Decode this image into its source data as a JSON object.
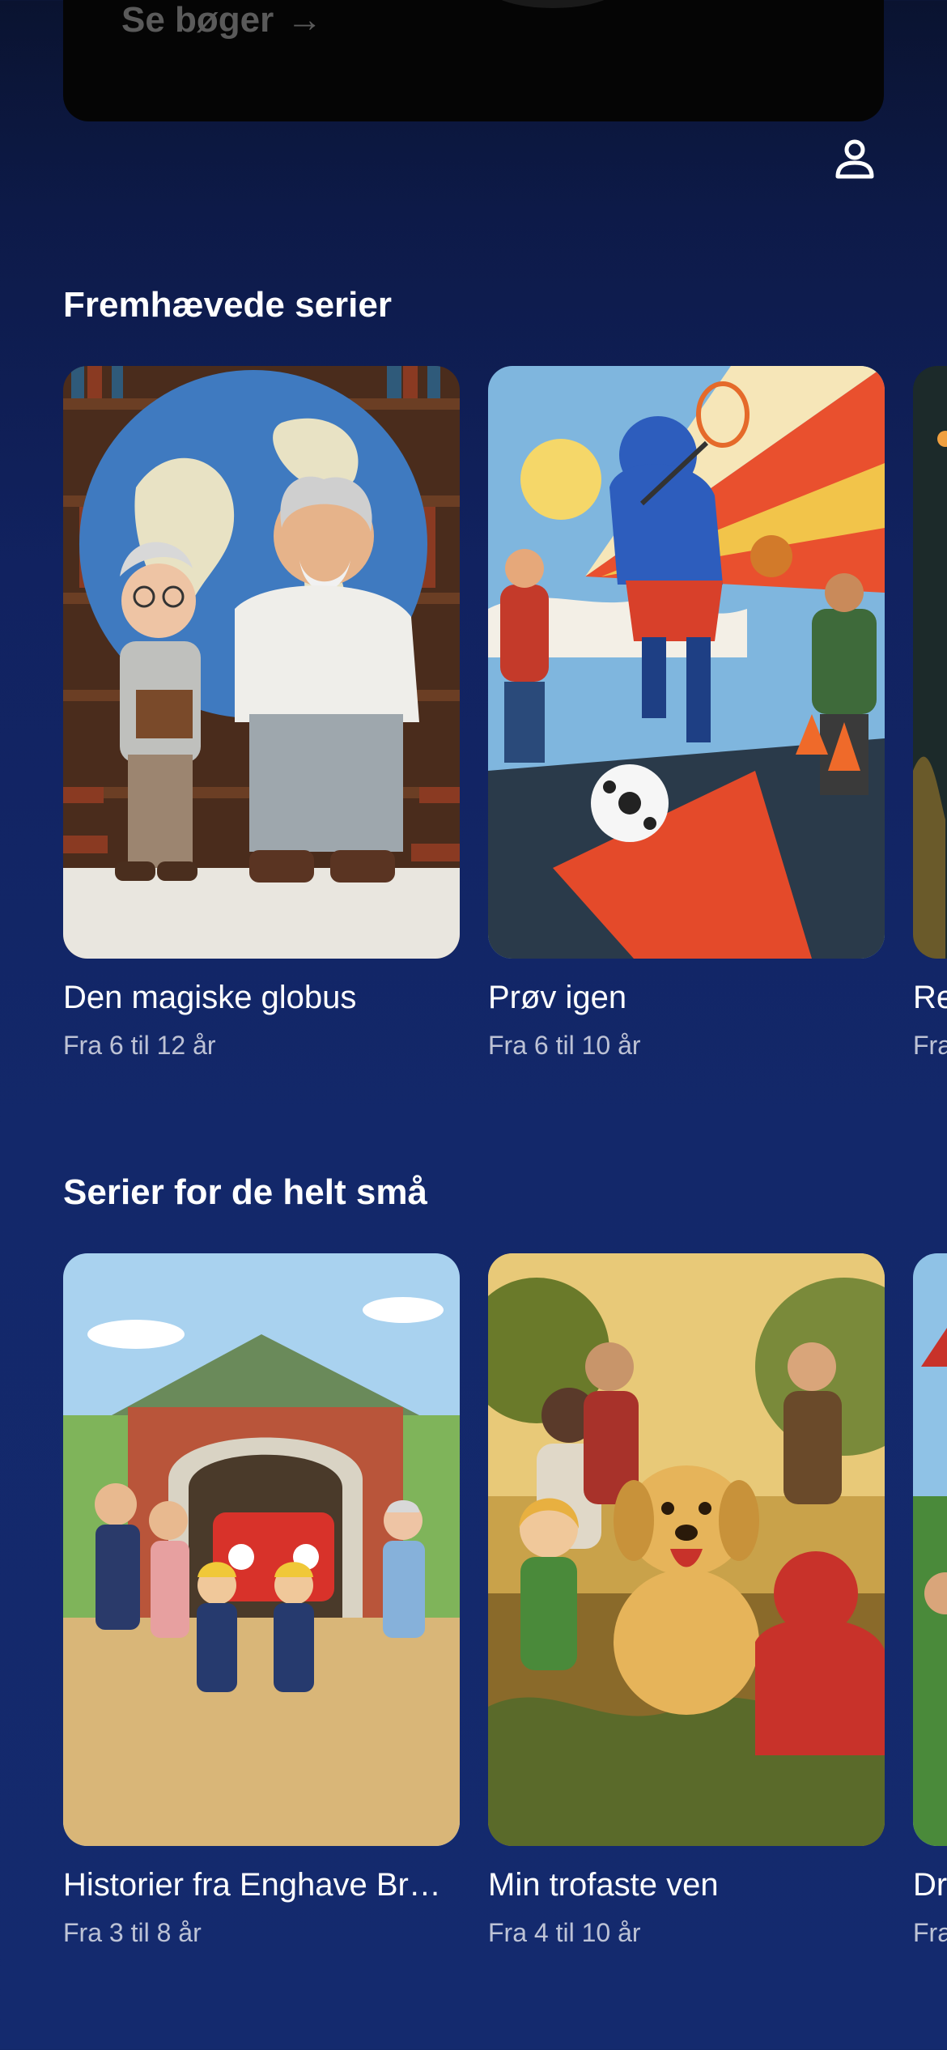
{
  "banner": {
    "see_books_label": "Se bøger",
    "arrow": "→"
  },
  "profile": {
    "icon": "user-icon"
  },
  "featured": {
    "title": "Fremhævede serier",
    "items": [
      {
        "title": "Den magiske globus",
        "age": "Fra 6 til 12 år"
      },
      {
        "title": "Prøv igen",
        "age": "Fra 6 til 10 år"
      },
      {
        "title": "Re",
        "age": "Fra"
      }
    ]
  },
  "little_ones": {
    "title": "Serier for de helt små",
    "items": [
      {
        "title": "Historier fra Enghave Br…",
        "age": "Fra 3 til 8 år"
      },
      {
        "title": "Min trofaste ven",
        "age": "Fra 4 til 10 år"
      },
      {
        "title": "Dr",
        "age": "Fra"
      }
    ]
  }
}
